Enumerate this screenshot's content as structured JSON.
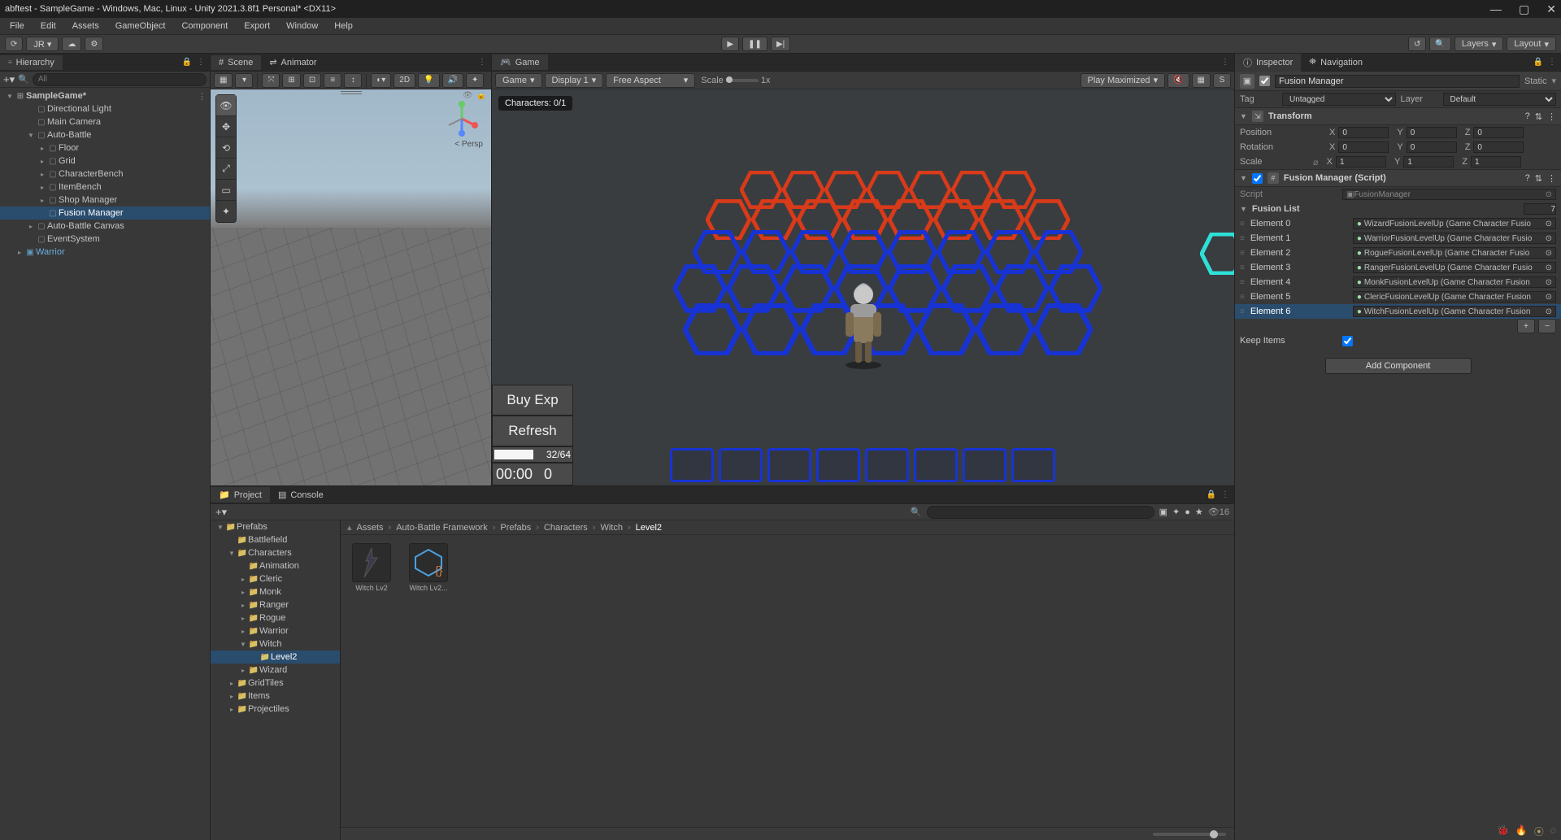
{
  "window": {
    "title": "abftest - SampleGame - Windows, Mac, Linux - Unity 2021.3.8f1 Personal* <DX11>"
  },
  "menu": [
    "File",
    "Edit",
    "Assets",
    "GameObject",
    "Component",
    "Export",
    "Window",
    "Help"
  ],
  "toolbar": {
    "account": "JR ▾",
    "layers": "Layers",
    "layout": "Layout"
  },
  "hierarchy": {
    "tab": "Hierarchy",
    "search_placeholder": "All",
    "scene": "SampleGame*",
    "items": [
      {
        "name": "Directional Light",
        "depth": 1
      },
      {
        "name": "Main Camera",
        "depth": 1
      },
      {
        "name": "Auto-Battle",
        "depth": 1,
        "expand": true
      },
      {
        "name": "Floor",
        "depth": 2,
        "exp": true
      },
      {
        "name": "Grid",
        "depth": 2,
        "exp": true
      },
      {
        "name": "CharacterBench",
        "depth": 2,
        "exp": true
      },
      {
        "name": "ItemBench",
        "depth": 2,
        "exp": true
      },
      {
        "name": "Shop Manager",
        "depth": 2,
        "exp": true
      },
      {
        "name": "Fusion Manager",
        "depth": 2,
        "selected": true
      },
      {
        "name": "Auto-Battle Canvas",
        "depth": 1,
        "exp": true
      },
      {
        "name": "EventSystem",
        "depth": 1
      },
      {
        "name": "Warrior",
        "depth": 0,
        "exp": true,
        "prefab": true
      }
    ]
  },
  "scene": {
    "tab": "Scene",
    "animTab": "Animator",
    "persp": "< Persp"
  },
  "game": {
    "tab": "Game",
    "dropdown": "Game",
    "display": "Display 1",
    "aspect": "Free Aspect",
    "scaleLabel": "Scale",
    "scaleValue": "1x",
    "playmode": "Play Maximized",
    "characters": "Characters: 0/1",
    "buyExp": "Buy Exp",
    "refresh": "Refresh",
    "xp": "32/64",
    "time": "00:00",
    "gold": "0"
  },
  "project": {
    "tab": "Project",
    "consoleTab": "Console",
    "hidden": "16",
    "tree": [
      {
        "name": "Prefabs",
        "depth": 0,
        "open": true
      },
      {
        "name": "Battlefield",
        "depth": 1
      },
      {
        "name": "Characters",
        "depth": 1,
        "open": true
      },
      {
        "name": "Animation",
        "depth": 2
      },
      {
        "name": "Cleric",
        "depth": 2,
        "exp": true
      },
      {
        "name": "Monk",
        "depth": 2,
        "exp": true
      },
      {
        "name": "Ranger",
        "depth": 2,
        "exp": true
      },
      {
        "name": "Rogue",
        "depth": 2,
        "exp": true
      },
      {
        "name": "Warrior",
        "depth": 2,
        "exp": true
      },
      {
        "name": "Witch",
        "depth": 2,
        "open": true
      },
      {
        "name": "Level2",
        "depth": 3,
        "selected": true
      },
      {
        "name": "Wizard",
        "depth": 2,
        "exp": true
      },
      {
        "name": "GridTiles",
        "depth": 1,
        "exp": true
      },
      {
        "name": "Items",
        "depth": 1,
        "exp": true
      },
      {
        "name": "Projectiles",
        "depth": 1,
        "exp": true
      }
    ],
    "breadcrumb": [
      "Assets",
      "Auto-Battle Framework",
      "Prefabs",
      "Characters",
      "Witch",
      "Level2"
    ],
    "items": [
      {
        "label": "Witch Lv2",
        "type": "prefab"
      },
      {
        "label": "Witch Lv2...",
        "type": "variant"
      }
    ]
  },
  "inspector": {
    "tab": "Inspector",
    "navTab": "Navigation",
    "objectName": "Fusion Manager",
    "static": "Static",
    "tagLabel": "Tag",
    "tag": "Untagged",
    "layerLabel": "Layer",
    "layer": "Default",
    "transform": {
      "title": "Transform",
      "posLabel": "Position",
      "rotLabel": "Rotation",
      "scaleLabel": "Scale",
      "pos": {
        "x": "0",
        "y": "0",
        "z": "0"
      },
      "rot": {
        "x": "0",
        "y": "0",
        "z": "0"
      },
      "scale": {
        "x": "1",
        "y": "1",
        "z": "1"
      }
    },
    "script": {
      "title": "Fusion Manager (Script)",
      "scriptLabel": "Script",
      "scriptValue": "FusionManager",
      "listLabel": "Fusion List",
      "listCount": "7",
      "elements": [
        {
          "name": "Element 0",
          "value": "WizardFusionLevelUp (Game Character Fusio"
        },
        {
          "name": "Element 1",
          "value": "WarriorFusionLevelUp (Game Character Fusio"
        },
        {
          "name": "Element 2",
          "value": "RogueFusionLevelUp (Game Character Fusio"
        },
        {
          "name": "Element 3",
          "value": "RangerFusionLevelUp (Game Character Fusio"
        },
        {
          "name": "Element 4",
          "value": "MonkFusionLevelUp (Game Character Fusion"
        },
        {
          "name": "Element 5",
          "value": "ClericFusionLevelUp (Game Character Fusion"
        },
        {
          "name": "Element 6",
          "value": "WitchFusionLevelUp (Game Character Fusion",
          "selected": true
        }
      ],
      "keepItemsLabel": "Keep Items",
      "keepItems": true
    },
    "addComponent": "Add Component"
  }
}
